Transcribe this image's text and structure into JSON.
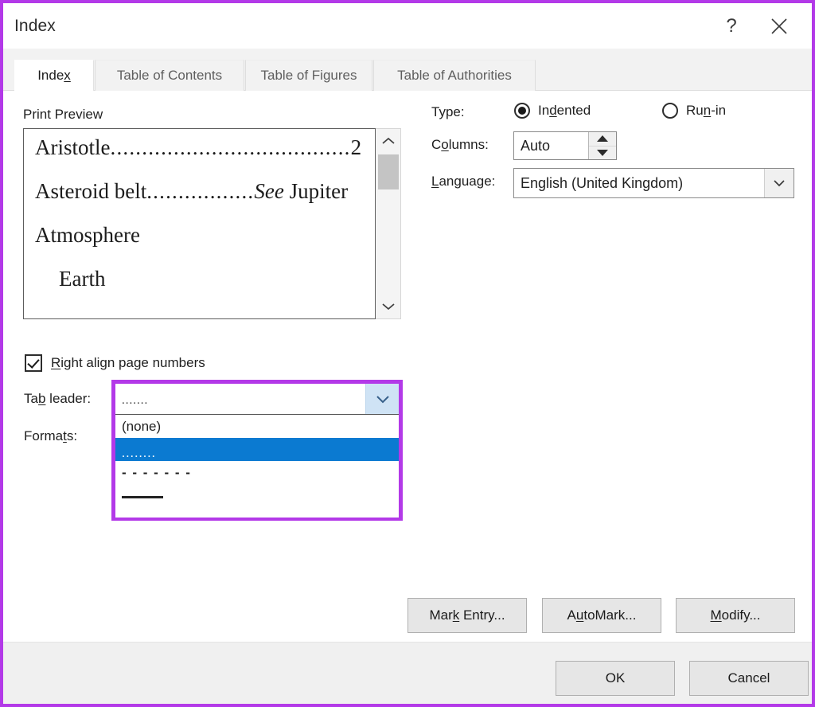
{
  "window": {
    "title": "Index",
    "help_icon": "question-mark-icon",
    "close_icon": "close-icon"
  },
  "tabs": [
    {
      "label": "Index",
      "accel": "x",
      "active": true
    },
    {
      "label": "Table of Contents",
      "active": false
    },
    {
      "label": "Table of Figures",
      "active": false
    },
    {
      "label": "Table of Authorities",
      "active": false
    }
  ],
  "preview": {
    "label": "Print Preview",
    "entries": [
      {
        "text": "Aristotle",
        "leader": "......................................",
        "page": "2",
        "indent": false
      },
      {
        "text": "Asteroid belt",
        "leader": ".................",
        "cross_ref_italic": "See",
        "cross_ref": " Jupiter",
        "indent": false
      },
      {
        "text": "Atmosphere",
        "indent": false
      },
      {
        "text": "Earth",
        "indent": true
      }
    ],
    "scrollbar": {
      "up_icon": "chevron-up-icon",
      "down_icon": "chevron-down-icon"
    }
  },
  "options": {
    "type_label": "Type:",
    "type_options": [
      {
        "label": "Indented",
        "accel": "d",
        "selected": true
      },
      {
        "label": "Run-in",
        "accel": "n",
        "selected": false
      }
    ],
    "columns_label": "Columns:",
    "columns_value": "Auto",
    "columns_up_icon": "spinner-up-icon",
    "columns_down_icon": "spinner-down-icon",
    "language_label": "Language:",
    "language_value": "English (United Kingdom)",
    "language_arrow_icon": "chevron-down-icon"
  },
  "right_align": {
    "label": "Right align page numbers",
    "accel": "R",
    "checked": true
  },
  "tab_leader": {
    "label": "Tab leader:",
    "accel": "b",
    "current_value": ".......",
    "arrow_icon": "chevron-down-icon",
    "options": [
      {
        "label": "(none)",
        "kind": "text",
        "selected": false
      },
      {
        "label": "........",
        "kind": "dots",
        "selected": true
      },
      {
        "label": "- - - - - - -",
        "kind": "dashes",
        "selected": false
      },
      {
        "label": "______",
        "kind": "line",
        "selected": false
      }
    ]
  },
  "formats": {
    "label": "Formats:",
    "accel": "t"
  },
  "buttons": {
    "mark_entry": "Mark Entry...",
    "mark_entry_accel": "k",
    "automark": "AutoMark...",
    "automark_accel": "u",
    "modify": "Modify...",
    "modify_accel": "M",
    "ok": "OK",
    "cancel": "Cancel"
  },
  "colors": {
    "highlight_purple": "#b339e8",
    "selection_blue": "#0b7ad1",
    "combo_arrow_blue": "#cfe3f5"
  }
}
